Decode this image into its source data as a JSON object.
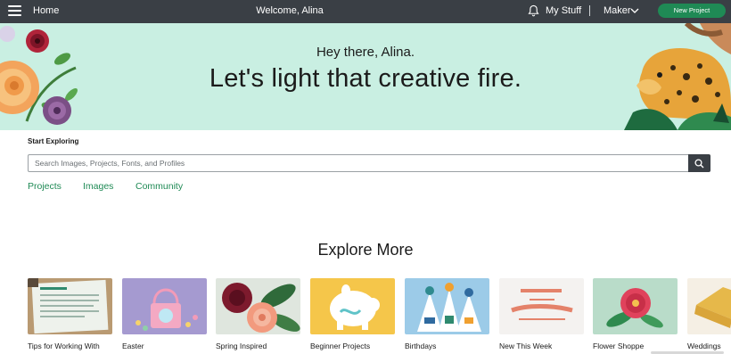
{
  "topbar": {
    "home_label": "Home",
    "welcome_text": "Welcome, Alina",
    "my_stuff_label": "My Stuff",
    "maker_label": "Maker",
    "new_project_label": "New Project",
    "bar_color": "#3a3f45",
    "button_color": "#1f8a55"
  },
  "banner": {
    "greeting": "Hey there, Alina.",
    "headline": "Let's light that creative fire.",
    "background": "#c9efe2"
  },
  "explore": {
    "heading": "Start Exploring",
    "search_placeholder": "Search Images, Projects, Fonts, and Profiles",
    "tabs": [
      "Projects",
      "Images",
      "Community"
    ],
    "more_title": "Explore More"
  },
  "cards": [
    {
      "label": "Tips for Working With Materials",
      "icon": "tips-sheet-thumbnail"
    },
    {
      "label": "Easter",
      "icon": "easter-basket-thumbnail"
    },
    {
      "label": "Spring Inspired",
      "icon": "paper-flowers-thumbnail"
    },
    {
      "label": "Beginner Projects",
      "icon": "piggy-bank-thumbnail"
    },
    {
      "label": "Birthdays",
      "icon": "party-hats-thumbnail"
    },
    {
      "label": "New This Week",
      "icon": "adventure-text-thumbnail"
    },
    {
      "label": "Flower Shoppe",
      "icon": "paper-rose-thumbnail"
    },
    {
      "label": "Weddings",
      "icon": "envelope-thumbnail"
    }
  ],
  "accent_color": "#1f8a55"
}
